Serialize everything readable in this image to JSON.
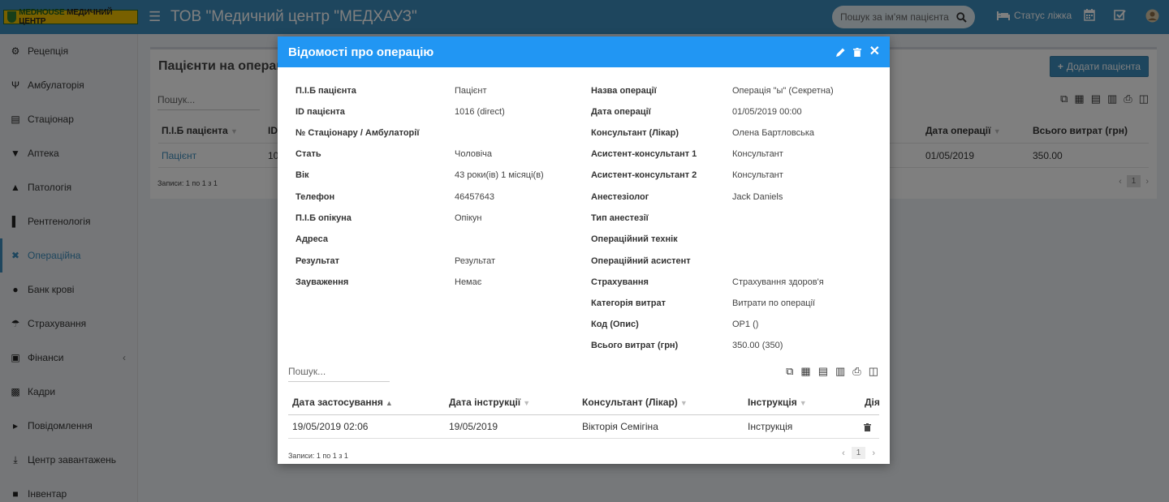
{
  "topbar": {
    "logo_brand": "MEDHOUSE",
    "logo_text": "МЕДИЧНИЙ ЦЕНТР",
    "title": "ТОВ \"Медичний центр \"МЕДХАУЗ\"",
    "search_placeholder": "Пошук за ім'ям пацієнта",
    "bed_status": "Статус ліжка"
  },
  "sidebar": {
    "items": [
      {
        "label": "Рецепція",
        "icon": "reception-icon"
      },
      {
        "label": "Амбулаторія",
        "icon": "stethoscope-icon"
      },
      {
        "label": "Стаціонар",
        "icon": "bed-icon"
      },
      {
        "label": "Аптека",
        "icon": "pharmacy-icon"
      },
      {
        "label": "Патологія",
        "icon": "flask-icon"
      },
      {
        "label": "Рентгенологія",
        "icon": "xray-icon"
      },
      {
        "label": "Операційна",
        "icon": "scissors-icon",
        "active": true
      },
      {
        "label": "Банк крові",
        "icon": "drop-icon"
      },
      {
        "label": "Страхування",
        "icon": "umbrella-icon"
      },
      {
        "label": "Фінанси",
        "icon": "money-icon"
      },
      {
        "label": "Кадри",
        "icon": "sitemap-icon"
      },
      {
        "label": "Повідомлення",
        "icon": "bullhorn-icon"
      },
      {
        "label": "Центр завантажень",
        "icon": "download-icon"
      },
      {
        "label": "Інвентар",
        "icon": "inventory-icon"
      }
    ]
  },
  "background": {
    "box_title": "Пацієнти на операції",
    "add_button": "Додати пацієнта",
    "search_placeholder": "Пошук...",
    "headers": {
      "patient": "П.І.Б пацієнта",
      "id": "ID",
      "date": "Дата операції",
      "total": "Всього витрат (грн)"
    },
    "row": {
      "patient": "Пацієнт",
      "id": "10",
      "date": "01/05/2019",
      "total": "350.00"
    },
    "records_info": "Записи: 1 по 1 з 1",
    "page": "1"
  },
  "modal": {
    "title": "Відомості про операцію",
    "left_fields": [
      {
        "label": "П.І.Б пацієнта",
        "value": "Пацієнт"
      },
      {
        "label": "ID пацієнта",
        "value": "1016 (direct)"
      },
      {
        "label": "№ Стаціонару / Амбулаторії",
        "value": ""
      },
      {
        "label": "Стать",
        "value": "Чоловіча"
      },
      {
        "label": "Вік",
        "value": "43 роки(ів) 1 місяці(в)"
      },
      {
        "label": "Телефон",
        "value": "46457643"
      },
      {
        "label": "П.І.Б опікуна",
        "value": "Опікун"
      },
      {
        "label": "Адреса",
        "value": ""
      },
      {
        "label": "Результат",
        "value": "Результат"
      },
      {
        "label": "Зауваження",
        "value": "Немає"
      }
    ],
    "right_fields": [
      {
        "label": "Назва операції",
        "value": "Операція \"ы\" (Секретна)"
      },
      {
        "label": "Дата операції",
        "value": "01/05/2019 00:00"
      },
      {
        "label": "Консультант (Лікар)",
        "value": "Олена Бартловська"
      },
      {
        "label": "Асистент-консультант 1",
        "value": "Консультант"
      },
      {
        "label": "Асистент-консультант 2",
        "value": "Консультант"
      },
      {
        "label": "Анестезіолог",
        "value": "Jack Daniels"
      },
      {
        "label": "Тип анестезії",
        "value": ""
      },
      {
        "label": "Операційний технік",
        "value": ""
      },
      {
        "label": "Операційний асистент",
        "value": ""
      },
      {
        "label": "Страхування",
        "value": "Страхування здоров'я"
      },
      {
        "label": "Категорія витрат",
        "value": "Витрати по операції"
      },
      {
        "label": "Код (Опис)",
        "value": "OP1 ()"
      },
      {
        "label": "Всього витрат (грн)",
        "value": "350.00 (350)"
      }
    ],
    "table": {
      "search_placeholder": "Пошук...",
      "headers": [
        "Дата застосування",
        "Дата інструкції",
        "Консультант (Лікар)",
        "Інструкція",
        "Дія"
      ],
      "rows": [
        [
          "19/05/2019 02:06",
          "19/05/2019",
          "Вікторія Семігіна",
          "Інструкція"
        ]
      ],
      "records_info": "Записи: 1 по 1 з 1",
      "page": "1"
    }
  }
}
